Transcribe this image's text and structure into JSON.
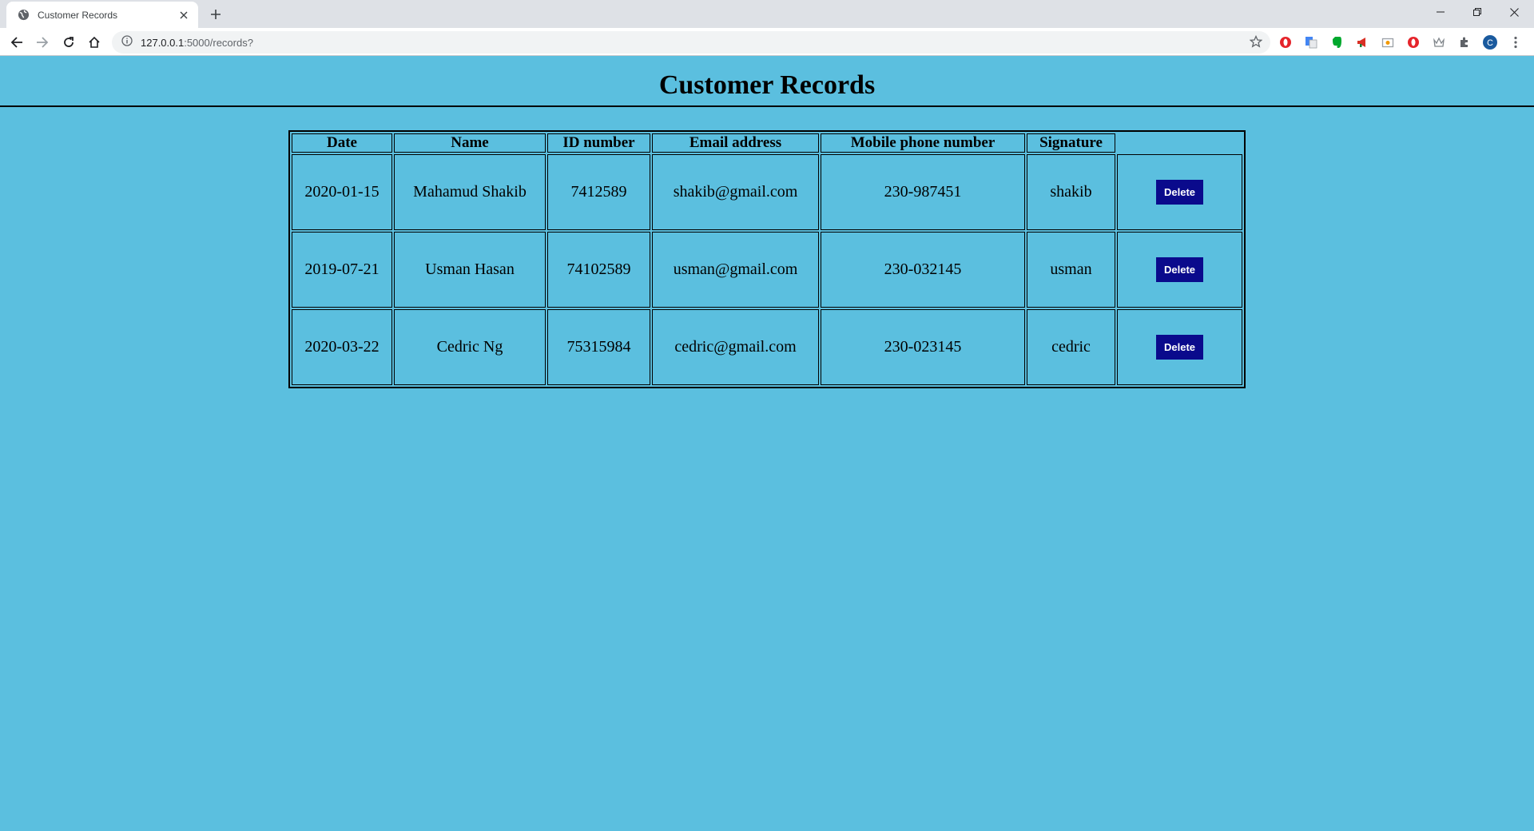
{
  "browser": {
    "tab_title": "Customer Records",
    "url_host": "127.0.0.1",
    "url_path": ":5000/records?"
  },
  "page": {
    "title": "Customer Records",
    "background": "#5bbfdf",
    "button_color": "#0a0a8c"
  },
  "table": {
    "headers": [
      "Date",
      "Name",
      "ID number",
      "Email address",
      "Mobile phone number",
      "Signature"
    ],
    "rows": [
      {
        "date": "2020-01-15",
        "name": "Mahamud Shakib",
        "id": "7412589",
        "email": "shakib@gmail.com",
        "mobile": "230-987451",
        "signature": "shakib",
        "action": "Delete"
      },
      {
        "date": "2019-07-21",
        "name": "Usman Hasan",
        "id": "74102589",
        "email": "usman@gmail.com",
        "mobile": "230-032145",
        "signature": "usman",
        "action": "Delete"
      },
      {
        "date": "2020-03-22",
        "name": "Cedric Ng",
        "id": "75315984",
        "email": "cedric@gmail.com",
        "mobile": "230-023145",
        "signature": "cedric",
        "action": "Delete"
      }
    ]
  }
}
